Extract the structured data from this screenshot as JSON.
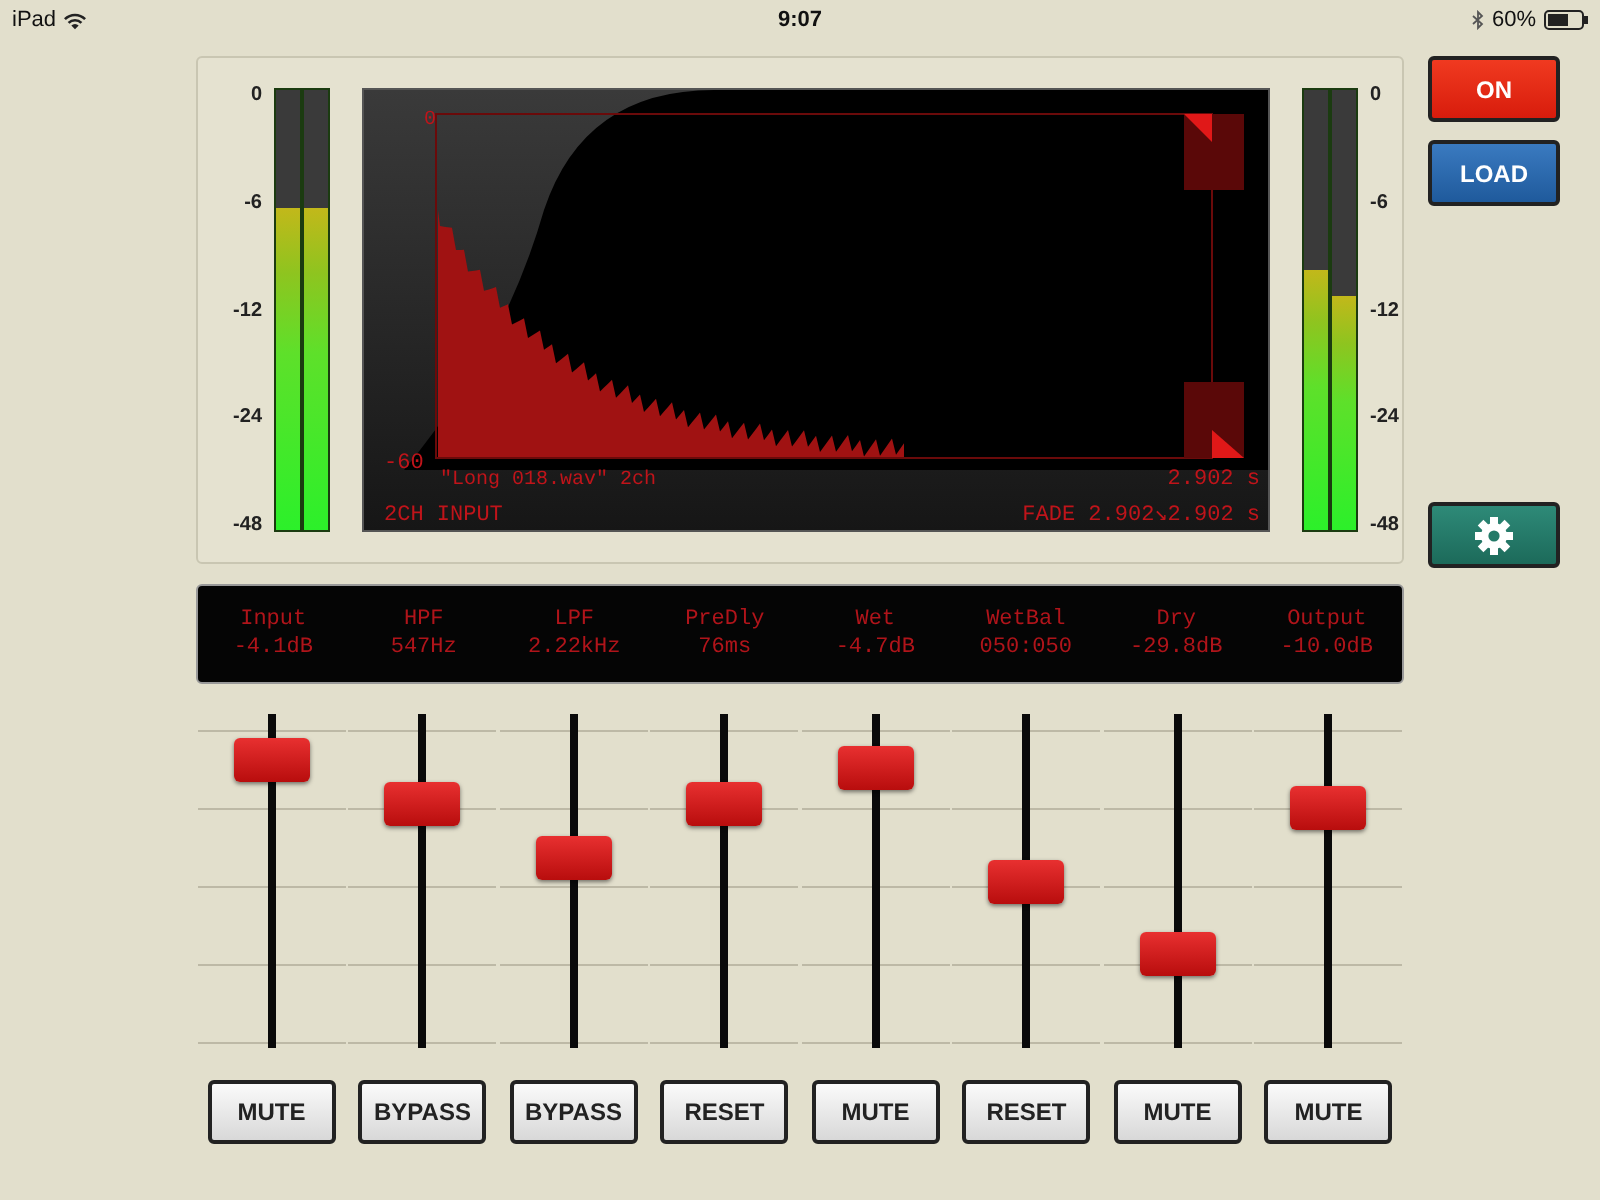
{
  "status_bar": {
    "device": "iPad",
    "time": "9:07",
    "battery": "60%"
  },
  "meters": [
    {
      "kind": "scaleleft",
      "scale": [
        "0",
        "-6",
        "-12",
        "-24",
        "-48"
      ],
      "bars": [
        {
          "level": 0.73
        },
        {
          "level": 0.73
        }
      ]
    },
    {
      "kind": "scaleright",
      "scale": [
        "0",
        "-6",
        "-12",
        "-24",
        "-48"
      ],
      "bars": [
        {
          "level": 0.59
        },
        {
          "level": 0.53
        }
      ]
    }
  ],
  "waveform": {
    "top_label": "0",
    "bottom_label": "-60",
    "file": "\"Long 018.wav\" 2ch",
    "source": "2CH INPUT",
    "length": "2.902 s",
    "fade": "FADE 2.902↘2.902 s"
  },
  "side_buttons": [
    {
      "kind": "power",
      "label": "ON"
    },
    {
      "kind": "load",
      "label": "LOAD"
    },
    {
      "kind": "settings"
    }
  ],
  "params": [
    {
      "name": "Input",
      "value": "-4.1dB"
    },
    {
      "name": "HPF",
      "value": "547Hz"
    },
    {
      "name": "LPF",
      "value": "2.22kHz"
    },
    {
      "name": "PreDly",
      "value": "76ms"
    },
    {
      "name": "Wet",
      "value": "-4.7dB"
    },
    {
      "name": "WetBal",
      "value": "050:050"
    },
    {
      "name": "Dry",
      "value": "-29.8dB"
    },
    {
      "name": "Output",
      "value": "-10.0dB"
    }
  ],
  "faders": [
    {
      "level": 0.86,
      "button": "MUTE"
    },
    {
      "level": 0.73,
      "button": "BYPASS"
    },
    {
      "level": 0.57,
      "button": "BYPASS"
    },
    {
      "level": 0.73,
      "button": "RESET"
    },
    {
      "level": 0.84,
      "button": "MUTE"
    },
    {
      "level": 0.5,
      "button": "RESET"
    },
    {
      "level": 0.28,
      "button": "MUTE"
    },
    {
      "level": 0.72,
      "button": "MUTE"
    }
  ]
}
